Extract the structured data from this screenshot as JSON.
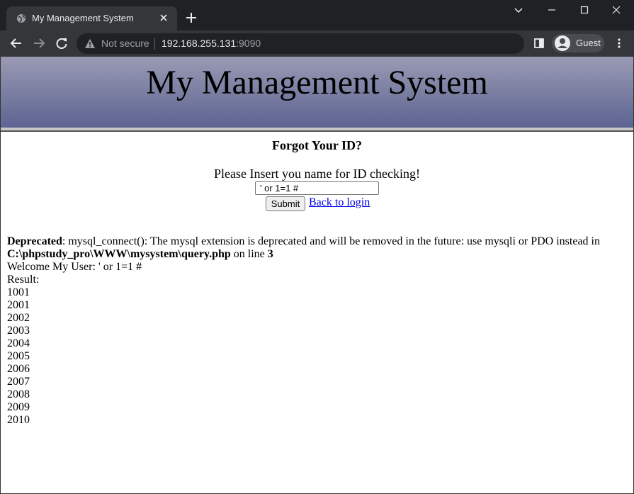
{
  "browser": {
    "tab_title": "My Management System",
    "security_label": "Not secure",
    "url_host": "192.168.255.131",
    "url_port": ":9090",
    "profile_name": "Guest"
  },
  "page": {
    "site_title": "My Management System",
    "heading": "Forgot Your ID?",
    "prompt": "Please Insert you name for ID checking!",
    "name_input_value": "' or 1=1 #",
    "submit_label": "Submit",
    "back_link": "Back to login",
    "warning": {
      "level": "Deprecated",
      "message": ": mysql_connect(): The mysql extension is deprecated and will be removed in the future: use mysqli or PDO instead in",
      "file": "C:\\phpstudy_pro\\WWW\\mysystem\\query.php",
      "line_text": " on line ",
      "line_number": "3"
    },
    "welcome": "Welcome My User: ' or 1=1 #",
    "result_label": "Result:",
    "results": [
      "1001",
      "2001",
      "2002",
      "2003",
      "2004",
      "2005",
      "2006",
      "2007",
      "2008",
      "2009",
      "2010"
    ]
  }
}
